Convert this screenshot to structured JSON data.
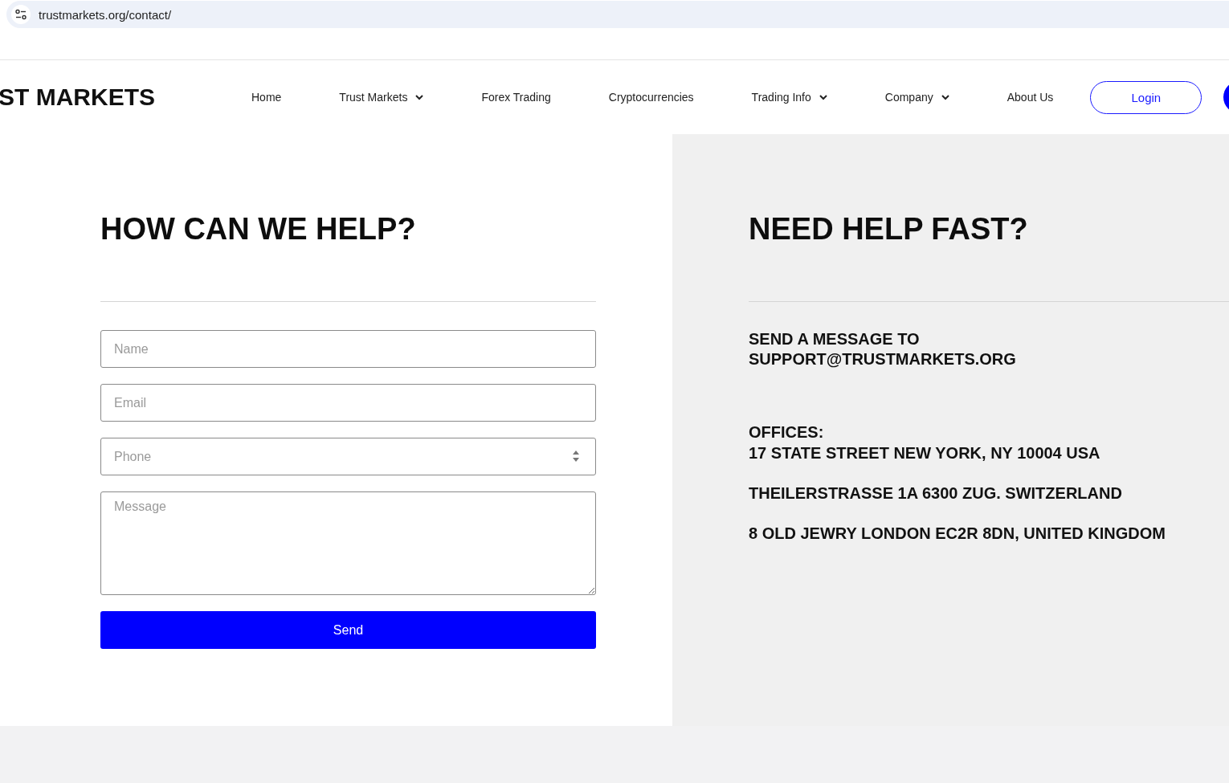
{
  "address_bar": {
    "url": "trustmarkets.org/contact/"
  },
  "header": {
    "logo": "ST MARKETS",
    "nav": [
      {
        "label": "Home",
        "dropdown": false
      },
      {
        "label": "Trust Markets",
        "dropdown": true
      },
      {
        "label": "Forex Trading",
        "dropdown": false
      },
      {
        "label": "Cryptocurrencies",
        "dropdown": false
      },
      {
        "label": "Trading Info",
        "dropdown": true
      },
      {
        "label": "Company",
        "dropdown": true
      },
      {
        "label": "About Us",
        "dropdown": false
      }
    ],
    "login": "Login"
  },
  "form": {
    "title": "HOW CAN WE HELP?",
    "fields": [
      {
        "kind": "text",
        "placeholder": "Name"
      },
      {
        "kind": "text",
        "placeholder": "Email"
      },
      {
        "kind": "number",
        "placeholder": "Phone"
      },
      {
        "kind": "textarea",
        "placeholder": "Message"
      }
    ],
    "submit": "Send"
  },
  "help": {
    "title": "NEED HELP FAST?",
    "message_lines": [
      "SEND A MESSAGE TO",
      "SUPPORT@TRUSTMARKETS.ORG"
    ],
    "offices_label": "OFFICES:",
    "offices": [
      "17 STATE STREET NEW YORK, NY 10004 USA",
      "THEILERSTRASSE 1A 6300 ZUG. SWITZERLAND",
      "8 OLD JEWRY LONDON EC2R 8DN, UNITED KINGDOM"
    ]
  }
}
